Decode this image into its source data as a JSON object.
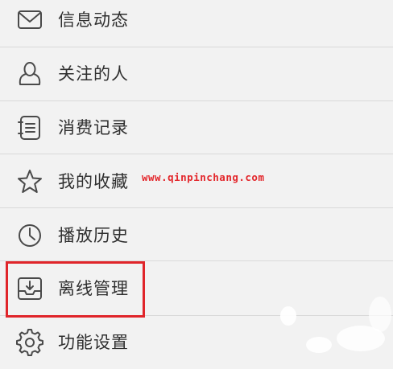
{
  "menu": {
    "items": [
      {
        "label": "信息动态",
        "icon": "mail-icon"
      },
      {
        "label": "关注的人",
        "icon": "person-icon"
      },
      {
        "label": "消费记录",
        "icon": "notebook-icon"
      },
      {
        "label": "我的收藏",
        "icon": "star-icon"
      },
      {
        "label": "播放历史",
        "icon": "clock-icon"
      },
      {
        "label": "离线管理",
        "icon": "download-tray-icon"
      },
      {
        "label": "功能设置",
        "icon": "gear-icon"
      }
    ]
  },
  "watermark": {
    "text": "www.qinpinchang.com"
  },
  "colors": {
    "background": "#f2f2f2",
    "text": "#2f2f2f",
    "icon_stroke": "#4a4a4a",
    "divider": "#d9d9d9",
    "highlight": "#e0252a",
    "watermark": "#e3262b"
  }
}
